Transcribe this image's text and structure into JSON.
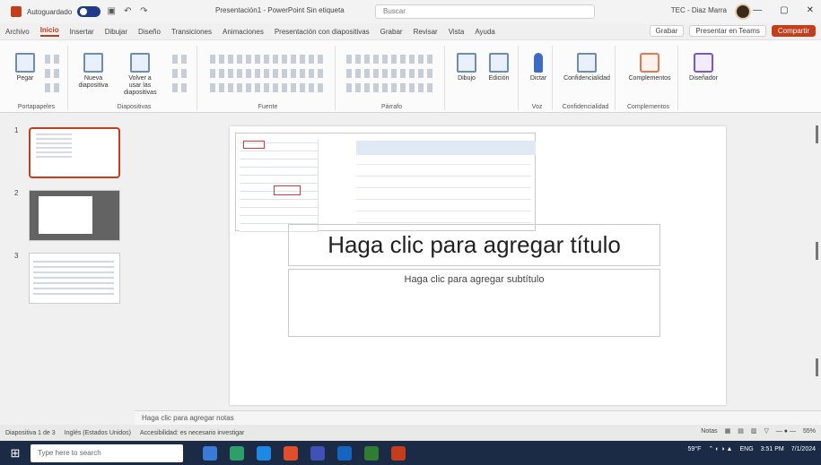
{
  "titlebar": {
    "autosave": "Autoguardado",
    "title": "Presentación1 - PowerPoint   Sin etiqueta",
    "search_placeholder": "Buscar",
    "user": "TEC - Diaz Marra"
  },
  "ribbon_tabs": [
    "Archivo",
    "Inicio",
    "Insertar",
    "Dibujar",
    "Diseño",
    "Transiciones",
    "Animaciones",
    "Presentación con diapositivas",
    "Grabar",
    "Revisar",
    "Vista",
    "Ayuda"
  ],
  "ribbon_actions": {
    "grabar": "Grabar",
    "presentar": "Presentar en Teams",
    "share": "Compartir"
  },
  "ribbon": {
    "paste": "Pegar",
    "clipboard": "Portapapeles",
    "new_slide": "Nueva diapositiva",
    "reuse": "Volver a usar las diapositivas",
    "slides_group": "Diapositivas",
    "font_group": "Fuente",
    "para_group": "Párrafo",
    "drawing": "Dibujo",
    "editing": "Edición",
    "dictate": "Dictar",
    "voice": "Voz",
    "sensitivity": "Confidencialidad",
    "addins": "Complementos",
    "designer": "Diseñador"
  },
  "thumbs": [
    "1",
    "2",
    "3"
  ],
  "slide": {
    "title_placeholder": "Haga clic para agregar título",
    "subtitle_placeholder": "Haga clic para agregar subtítulo"
  },
  "notes_placeholder": "Haga clic para agregar notas",
  "status": {
    "slide": "Diapositiva 1 de 3",
    "lang": "Inglés (Estados Unidos)",
    "accessibility": "Accesibilidad: es necesario investigar",
    "notes": "Notas",
    "zoom": "55%"
  },
  "taskbar": {
    "search": "Type here to search",
    "weather": "59°F",
    "lang": "ENG",
    "time": "3:51 PM",
    "date": "7/1/2024"
  }
}
